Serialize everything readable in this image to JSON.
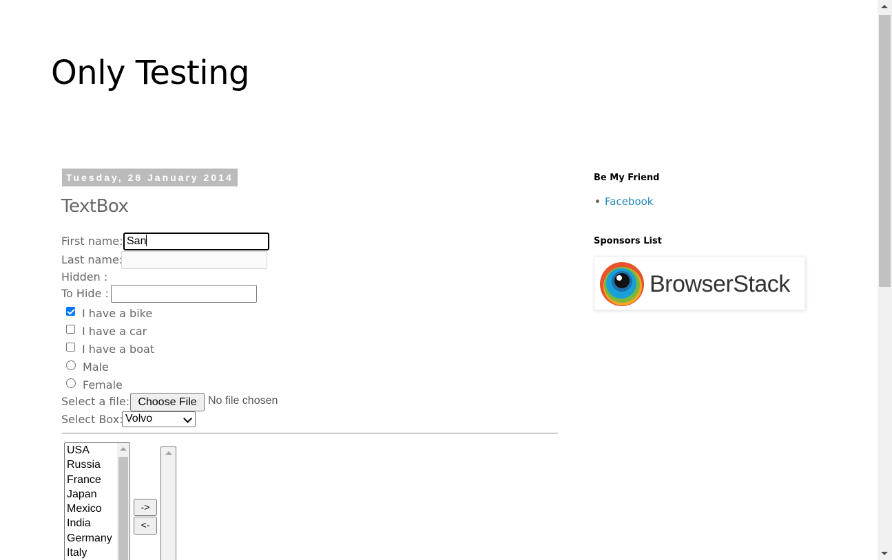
{
  "blog": {
    "title": "Only Testing"
  },
  "post": {
    "date": "Tuesday, 28 January 2014",
    "title": "TextBox"
  },
  "form": {
    "first_name_label": "First name:",
    "first_name_value": "San",
    "last_name_label": "Last name:",
    "last_name_value": "",
    "hidden_label": "Hidden :",
    "to_hide_label": "To Hide :",
    "to_hide_value": "",
    "checkboxes": [
      {
        "label": "I have a bike",
        "checked": true
      },
      {
        "label": "I have a car",
        "checked": false
      },
      {
        "label": "I have a boat",
        "checked": false
      }
    ],
    "radios": [
      {
        "label": "Male",
        "selected": false
      },
      {
        "label": "Female",
        "selected": false
      }
    ],
    "file_label": "Select a file:",
    "file_button": "Choose File",
    "file_status": "No file chosen",
    "select_label": "Select Box:",
    "select_value": "Volvo"
  },
  "listbox": {
    "countries": [
      "USA",
      "Russia",
      "France",
      "Japan",
      "Mexico",
      "India",
      "Germany",
      "Italy"
    ],
    "move_right_label": "->",
    "move_left_label": "<-"
  },
  "sidebar": {
    "friend_heading": "Be My Friend",
    "friend_links": [
      "Facebook"
    ],
    "sponsors_heading": "Sponsors List",
    "sponsor_name": "BrowserStack"
  },
  "colors": {
    "link": "#2288bb",
    "checkbox_accent": "#0075ff",
    "date_header_bg": "#bbbbbb"
  }
}
